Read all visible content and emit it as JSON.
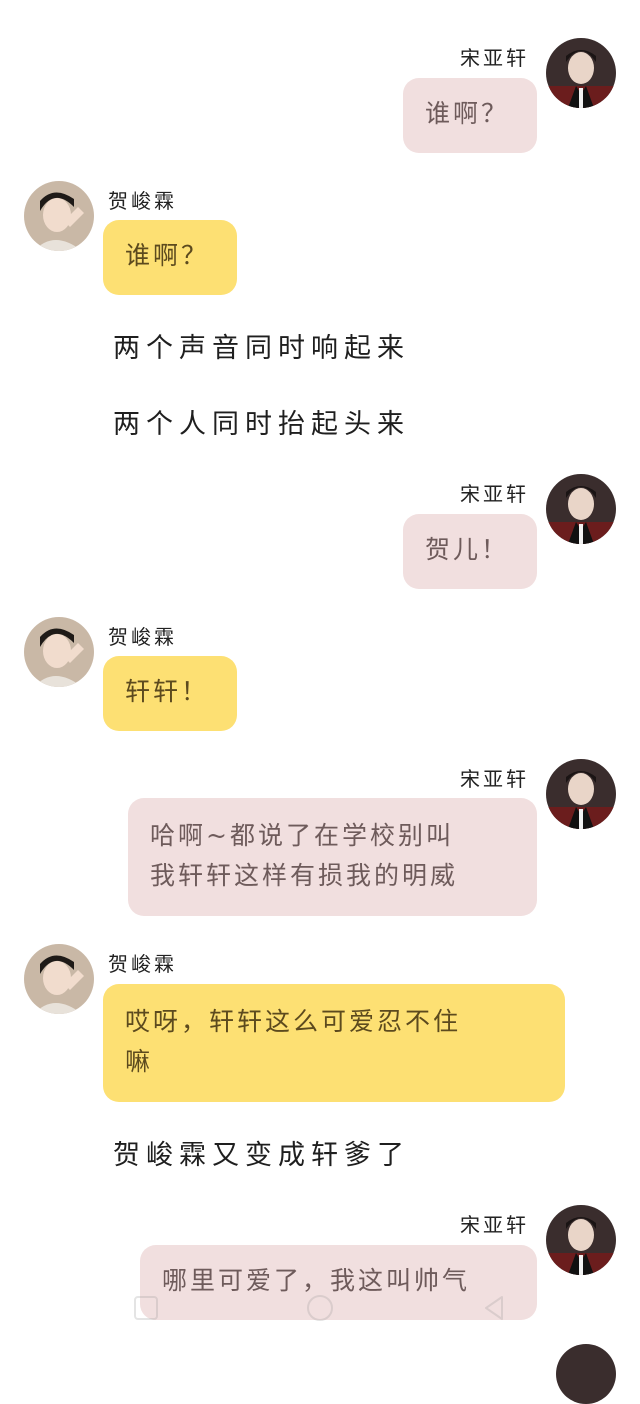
{
  "characters": {
    "right_name": "宋亚轩",
    "left_name": "贺峻霖"
  },
  "messages": [
    {
      "side": "right",
      "name": "宋亚轩",
      "text": "谁啊？"
    },
    {
      "side": "left",
      "name": "贺峻霖",
      "text": "谁啊？"
    },
    {
      "side": "narration",
      "text": "两个声音同时响起来"
    },
    {
      "side": "narration",
      "text": "两个人同时抬起头来"
    },
    {
      "side": "right",
      "name": "宋亚轩",
      "text": "贺儿！"
    },
    {
      "side": "left",
      "name": "贺峻霖",
      "text": "轩轩！"
    },
    {
      "side": "right",
      "name": "宋亚轩",
      "lines": [
        "哈啊~都说了在学校别叫",
        "我轩轩这样有损我的明威"
      ]
    },
    {
      "side": "left",
      "name": "贺峻霖",
      "lines": [
        "哎呀，轩轩这么可爱忍不住",
        "嘛"
      ]
    },
    {
      "side": "narration",
      "text": "贺峻霖又变成轩爹了"
    },
    {
      "side": "right",
      "name": "宋亚轩",
      "text": "哪里可爱了，我这叫帅气"
    }
  ],
  "colors": {
    "right_bubble": "#f1dfdf",
    "left_bubble": "#fde073",
    "background": "#ffffff"
  },
  "icons": {
    "nav_left": "square-recents-icon",
    "nav_center": "circle-home-icon",
    "nav_right": "triangle-back-icon"
  }
}
